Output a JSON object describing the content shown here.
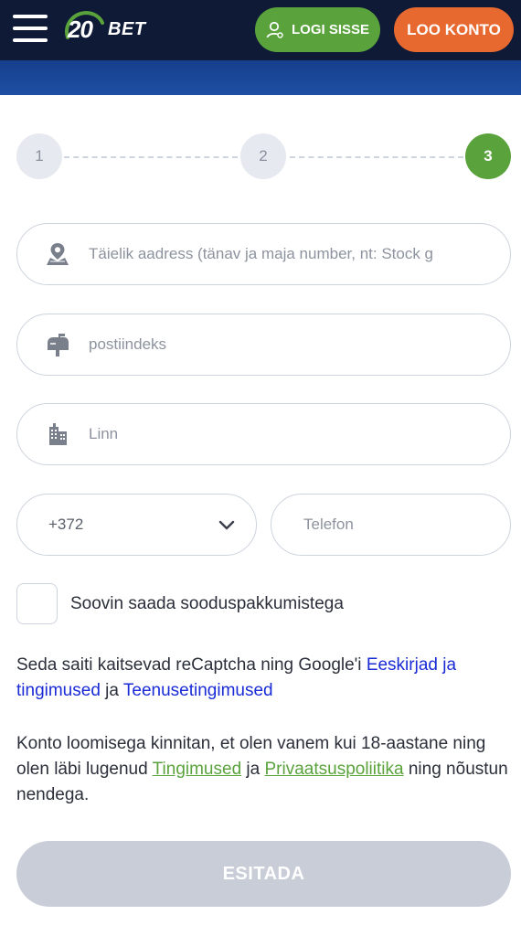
{
  "header": {
    "logo_number": "20",
    "logo_word": "BET",
    "login_label": "LOGI SISSE",
    "create_account_label": "LOO KONTO",
    "colors": {
      "background": "#0f1a36",
      "banner": "#1d4fa3",
      "login": "#5aa33c",
      "create": "#e8692f"
    }
  },
  "steps": [
    {
      "label": "1",
      "active": false
    },
    {
      "label": "2",
      "active": false
    },
    {
      "label": "3",
      "active": true
    }
  ],
  "form": {
    "address": {
      "placeholder": "Täielik aadress (tänav ja maja number, nt: Stock g",
      "icon": "map-pin-icon"
    },
    "postcode": {
      "placeholder": "postiindeks",
      "icon": "mailbox-icon"
    },
    "city": {
      "placeholder": "Linn",
      "icon": "building-icon"
    },
    "phone_code": {
      "value": "+372",
      "icon": "chevron-down-icon"
    },
    "phone": {
      "placeholder": "Telefon"
    },
    "promo_checkbox": {
      "label": "Soovin saada sooduspakkumistega",
      "checked": false
    }
  },
  "recaptcha": {
    "text": "Seda saiti kaitsevad reCaptcha ning Google'i",
    "link1": "Eeskirjad ja tingimused",
    "connector": "ja",
    "link2": "Teenusetingimused"
  },
  "consent": {
    "text1": "Konto loomisega kinnitan, et olen vanem kui 18-aastane ning olen läbi lugenud",
    "link1": "Tingimused",
    "connector": "ja",
    "link2": "Privaatsuspoliitika",
    "text2": "ning nõustun nendega."
  },
  "submit_label": "ESITADA"
}
